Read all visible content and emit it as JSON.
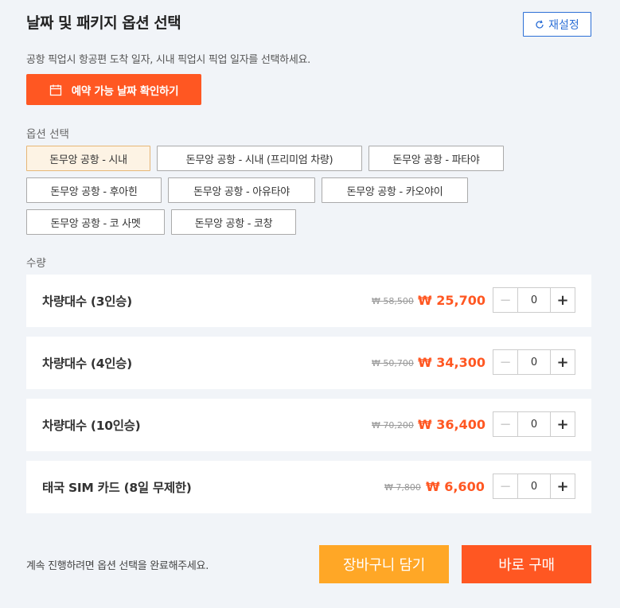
{
  "header": {
    "title": "날짜 및 패키지 옵션 선택",
    "reset_label": "재설정"
  },
  "subtitle": "공항 픽업시 항공편 도착 일자, 시내 픽업시 픽업 일자를 선택하세요.",
  "calendar_button_label": "예약 가능 날짜 확인하기",
  "options": {
    "label": "옵션 선택",
    "items": [
      {
        "label": "돈무앙 공항 - 시내",
        "selected": true
      },
      {
        "label": "돈무앙 공항 - 시내 (프리미엄 차량)",
        "selected": false
      },
      {
        "label": "돈무앙 공항 - 파타야",
        "selected": false
      },
      {
        "label": "돈무앙 공항 - 후아힌",
        "selected": false
      },
      {
        "label": "돈무앙 공항 - 아유타야",
        "selected": false
      },
      {
        "label": "돈무앙 공항 - 카오야이",
        "selected": false
      },
      {
        "label": "돈무앙 공항 - 코 사멧",
        "selected": false
      },
      {
        "label": "돈무앙 공항 - 코창",
        "selected": false
      }
    ]
  },
  "quantity": {
    "label": "수량",
    "rows": [
      {
        "label": "차량대수 (3인승)",
        "original_price": "₩ 58,500",
        "sale_price": "₩ 25,700",
        "qty": "0"
      },
      {
        "label": "차량대수 (4인승)",
        "original_price": "₩ 50,700",
        "sale_price": "₩ 34,300",
        "qty": "0"
      },
      {
        "label": "차량대수 (10인승)",
        "original_price": "₩ 70,200",
        "sale_price": "₩ 36,400",
        "qty": "0"
      },
      {
        "label": "태국 SIM 카드 (8일 무제한)",
        "original_price": "₩ 7,800",
        "sale_price": "₩ 6,600",
        "qty": "0"
      }
    ]
  },
  "footer": {
    "note": "계속 진행하려면 옵션 선택을 완료해주세요.",
    "cart_label": "장바구니 담기",
    "buy_label": "바로 구매"
  },
  "colors": {
    "accent": "#ff5722",
    "cart": "#ffa726",
    "reset": "#2c6fd6",
    "selected_bg": "#fdf3e4"
  }
}
